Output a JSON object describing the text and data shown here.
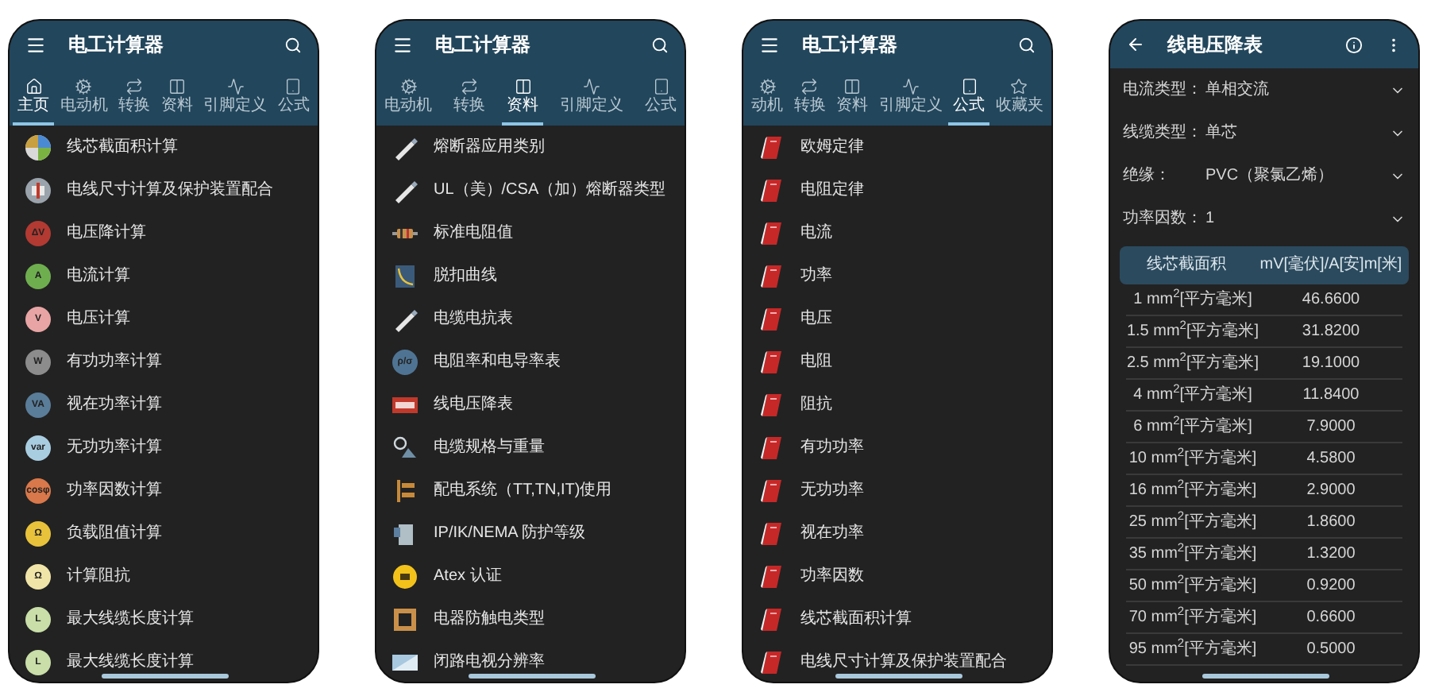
{
  "screens": [
    {
      "kind": "list",
      "title": "电工计算器",
      "tabs": [
        {
          "label": "主页",
          "kind": "home",
          "selected": true
        },
        {
          "label": "电动机",
          "kind": "motor",
          "selected": false
        },
        {
          "label": "转换",
          "kind": "convert",
          "selected": false
        },
        {
          "label": "资料",
          "kind": "table",
          "selected": false
        },
        {
          "label": "引脚定义",
          "kind": "pin",
          "selected": false
        },
        {
          "label": "公式",
          "kind": "formula",
          "selected": false
        }
      ],
      "items": [
        {
          "label": "线芯截面积计算",
          "icon": {
            "kind": "globe"
          }
        },
        {
          "label": "电线尺寸计算及保护装置配合",
          "icon": {
            "kind": "cable"
          }
        },
        {
          "label": "电压降计算",
          "icon": {
            "kind": "badge",
            "color": "#b23a32",
            "glyph": "ΔV"
          }
        },
        {
          "label": "电流计算",
          "icon": {
            "kind": "badge",
            "color": "#6fae4f",
            "glyph": "A"
          }
        },
        {
          "label": "电压计算",
          "icon": {
            "kind": "badge",
            "color": "#e8a4a4",
            "glyph": "V"
          }
        },
        {
          "label": "有功功率计算",
          "icon": {
            "kind": "badge",
            "color": "#8c8c8c",
            "glyph": "W"
          }
        },
        {
          "label": "视在功率计算",
          "icon": {
            "kind": "badge",
            "color": "#5a7d99",
            "glyph": "VA"
          }
        },
        {
          "label": "无功功率计算",
          "icon": {
            "kind": "badge",
            "color": "#a9cde0",
            "glyph": "var"
          }
        },
        {
          "label": "功率因数计算",
          "icon": {
            "kind": "badge",
            "color": "#d9784a",
            "glyph": "cosφ"
          }
        },
        {
          "label": "负载阻值计算",
          "icon": {
            "kind": "badge",
            "color": "#e8c23a",
            "glyph": "Ω"
          }
        },
        {
          "label": "计算阻抗",
          "icon": {
            "kind": "badge",
            "color": "#f0e4a8",
            "glyph": "Ω"
          }
        },
        {
          "label": "最大线缆长度计算",
          "icon": {
            "kind": "badge",
            "color": "#c9dea8",
            "glyph": "L"
          }
        },
        {
          "label": "最大线缆长度计算",
          "icon": {
            "kind": "badge",
            "color": "#c9dea8",
            "glyph": "L"
          }
        }
      ]
    },
    {
      "kind": "list",
      "title": "电工计算器",
      "tabs": [
        {
          "label": "电动机",
          "kind": "motor",
          "selected": false
        },
        {
          "label": "转换",
          "kind": "convert",
          "selected": false
        },
        {
          "label": "资料",
          "kind": "table",
          "selected": true
        },
        {
          "label": "引脚定义",
          "kind": "pin",
          "selected": false
        },
        {
          "label": "公式",
          "kind": "formula",
          "selected": false
        }
      ],
      "items": [
        {
          "label": "熔断器应用类别",
          "icon": {
            "kind": "fuse"
          }
        },
        {
          "label": "UL（美）/CSA（加）熔断器类型",
          "icon": {
            "kind": "fuse"
          }
        },
        {
          "label": "标准电阻值",
          "icon": {
            "kind": "resistor"
          }
        },
        {
          "label": "脱扣曲线",
          "icon": {
            "kind": "curve"
          }
        },
        {
          "label": "电缆电抗表",
          "icon": {
            "kind": "fuse"
          }
        },
        {
          "label": "电阻率和电导率表",
          "icon": {
            "kind": "badge",
            "color": "#4f7493",
            "glyph": "ρ/σ"
          }
        },
        {
          "label": "线电压降表",
          "icon": {
            "kind": "flag"
          }
        },
        {
          "label": "电缆规格与重量",
          "icon": {
            "kind": "weight"
          }
        },
        {
          "label": "配电系统（TT,TN,IT)使用",
          "icon": {
            "kind": "panel"
          }
        },
        {
          "label": "IP/IK/NEMA 防护等级",
          "icon": {
            "kind": "device"
          }
        },
        {
          "label": "Atex 认证",
          "icon": {
            "kind": "hazard"
          }
        },
        {
          "label": "电器防触电类型",
          "icon": {
            "kind": "frame"
          }
        },
        {
          "label": "闭路电视分辨率",
          "icon": {
            "kind": "screen"
          }
        }
      ]
    },
    {
      "kind": "list",
      "title": "电工计算器",
      "tabs": [
        {
          "label": "动机",
          "kind": "motor",
          "selected": false
        },
        {
          "label": "转换",
          "kind": "convert",
          "selected": false
        },
        {
          "label": "资料",
          "kind": "table",
          "selected": false
        },
        {
          "label": "引脚定义",
          "kind": "pin",
          "selected": false
        },
        {
          "label": "公式",
          "kind": "formula",
          "selected": true
        },
        {
          "label": "收藏夹",
          "kind": "star",
          "selected": false
        }
      ],
      "items": [
        {
          "label": "欧姆定律",
          "icon": {
            "kind": "book"
          }
        },
        {
          "label": "电阻定律",
          "icon": {
            "kind": "book"
          }
        },
        {
          "label": "电流",
          "icon": {
            "kind": "book"
          }
        },
        {
          "label": "功率",
          "icon": {
            "kind": "book"
          }
        },
        {
          "label": "电压",
          "icon": {
            "kind": "book"
          }
        },
        {
          "label": "电阻",
          "icon": {
            "kind": "book"
          }
        },
        {
          "label": "阻抗",
          "icon": {
            "kind": "book"
          }
        },
        {
          "label": "有功功率",
          "icon": {
            "kind": "book"
          }
        },
        {
          "label": "无功功率",
          "icon": {
            "kind": "book"
          }
        },
        {
          "label": "视在功率",
          "icon": {
            "kind": "book"
          }
        },
        {
          "label": "功率因数",
          "icon": {
            "kind": "book"
          }
        },
        {
          "label": "线芯截面积计算",
          "icon": {
            "kind": "book"
          }
        },
        {
          "label": "电线尺寸计算及保护装置配合",
          "icon": {
            "kind": "book"
          }
        }
      ]
    },
    {
      "kind": "table",
      "title": "线电压降表",
      "fields": [
        {
          "label": "电流类型：",
          "value": "单相交流"
        },
        {
          "label": "线缆类型：",
          "value": "单芯"
        },
        {
          "label": "绝缘：",
          "value": "PVC（聚氯乙烯）"
        },
        {
          "label": "功率因数：",
          "value": "1"
        }
      ],
      "table": {
        "columns": [
          "线芯截面积",
          "mV[毫伏]/A[安]m[米]"
        ],
        "rows": [
          [
            "1 mm$^{2}$[平方毫米]",
            "46.6600"
          ],
          [
            "1.5 mm$^{2}$[平方毫米]",
            "31.8200"
          ],
          [
            "2.5 mm$^{2}$[平方毫米]",
            "19.1000"
          ],
          [
            "4 mm$^{2}$[平方毫米]",
            "11.8400"
          ],
          [
            "6 mm$^{2}$[平方毫米]",
            "7.9000"
          ],
          [
            "10 mm$^{2}$[平方毫米]",
            "4.5800"
          ],
          [
            "16 mm$^{2}$[平方毫米]",
            "2.9000"
          ],
          [
            "25 mm$^{2}$[平方毫米]",
            "1.8600"
          ],
          [
            "35 mm$^{2}$[平方毫米]",
            "1.3200"
          ],
          [
            "50 mm$^{2}$[平方毫米]",
            "0.9200"
          ],
          [
            "70 mm$^{2}$[平方毫米]",
            "0.6600"
          ],
          [
            "95 mm$^{2}$[平方毫米]",
            "0.5000"
          ]
        ]
      }
    }
  ]
}
